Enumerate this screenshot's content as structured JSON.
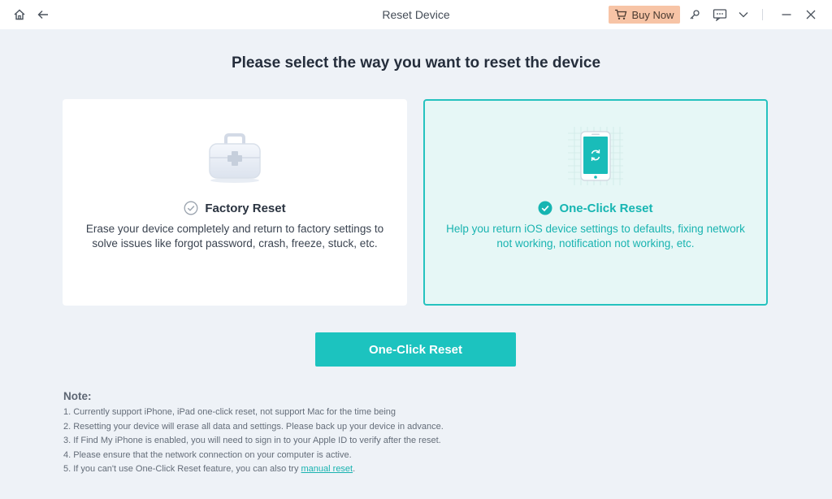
{
  "window": {
    "title": "Reset Device"
  },
  "toolbar": {
    "buy_label": "Buy Now"
  },
  "page": {
    "heading": "Please select the way you want to reset the device"
  },
  "options": [
    {
      "title": "Factory Reset",
      "description": "Erase your device completely and return to factory settings to solve issues like forgot password, crash, freeze, stuck, etc.",
      "selected": false
    },
    {
      "title": "One-Click Reset",
      "description": "Help you return iOS device settings to defaults, fixing network not working, notification not working, etc.",
      "selected": true
    }
  ],
  "action": {
    "label": "One-Click Reset"
  },
  "note": {
    "title": "Note:",
    "items": [
      "1. Currently support iPhone, iPad one-click reset, not support Mac for the time being",
      "2. Resetting your device will erase all data and settings. Please back up your device in advance.",
      "3. If Find My iPhone is enabled, you will need to sign in to your Apple ID to verify after the reset.",
      "4. Please ensure that the network connection on your computer is active."
    ],
    "last_prefix": "5. If you can't use One-Click Reset feature, you can also try ",
    "last_link": "manual reset",
    "last_suffix": "."
  },
  "colors": {
    "accent": "#1cc3bf",
    "buy_bg": "#f7c4a6",
    "background": "#eef2f7"
  }
}
